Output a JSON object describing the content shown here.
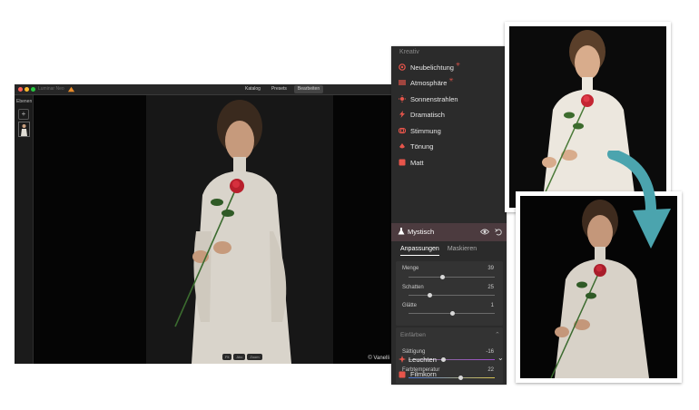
{
  "app": {
    "name": "Luminar Neo",
    "tabs": [
      {
        "label": "Katalog",
        "active": false
      },
      {
        "label": "Presets",
        "active": false
      },
      {
        "label": "Bearbeiten",
        "active": true
      }
    ],
    "sidebar": {
      "label": "Ebenen",
      "add_icon": "plus-icon"
    },
    "watermark": "© Vanelli",
    "zoom_buttons": [
      "Fit",
      "Abc",
      "Zoom"
    ]
  },
  "panel": {
    "section_title": "Kreativ",
    "items": [
      {
        "label": "Neubelichtung",
        "icon": "relight-icon",
        "color": "#e7554b",
        "ai": true
      },
      {
        "label": "Atmosphäre",
        "icon": "atmosphere-icon",
        "color": "#e7554b",
        "ai": true
      },
      {
        "label": "Sonnenstrahlen",
        "icon": "sunrays-icon",
        "color": "#e7554b",
        "ai": false
      },
      {
        "label": "Dramatisch",
        "icon": "dramatic-icon",
        "color": "#e7554b",
        "ai": false
      },
      {
        "label": "Stimmung",
        "icon": "mood-icon",
        "color": "#e7554b",
        "ai": false
      },
      {
        "label": "Tönung",
        "icon": "toning-icon",
        "color": "#e7554b",
        "ai": false
      },
      {
        "label": "Matt",
        "icon": "matte-icon",
        "color": "#e7554b",
        "ai": false
      }
    ],
    "active_tool": {
      "label": "Mystisch",
      "icon": "flask-icon"
    },
    "tabs": [
      {
        "label": "Anpassungen",
        "active": true
      },
      {
        "label": "Maskieren",
        "active": false
      }
    ],
    "sliders": [
      {
        "label": "Menge",
        "value": "39",
        "fraction": 0.39
      },
      {
        "label": "Schatten",
        "value": "25",
        "fraction": 0.25
      },
      {
        "label": "Glätte",
        "value": "1",
        "fraction": 0.51
      }
    ],
    "group": {
      "label": "Einfärben",
      "expanded": true
    },
    "color_sliders": [
      {
        "label": "Sättigung",
        "value": "-16",
        "fraction": 0.4,
        "kind": "sat"
      },
      {
        "label": "Farbtemperatur",
        "value": "22",
        "fraction": 0.61,
        "kind": "temp"
      }
    ],
    "next_tool": {
      "label": "Leuchten",
      "icon": "glow-icon"
    },
    "last_tool": {
      "label": "Filmkorn",
      "icon": "grain-icon"
    }
  },
  "colors": {
    "accent": "#e7554b",
    "arrow": "#4ba4ae",
    "panel_bg": "#2b2b2b",
    "selected_row": "#4c3b3f"
  }
}
